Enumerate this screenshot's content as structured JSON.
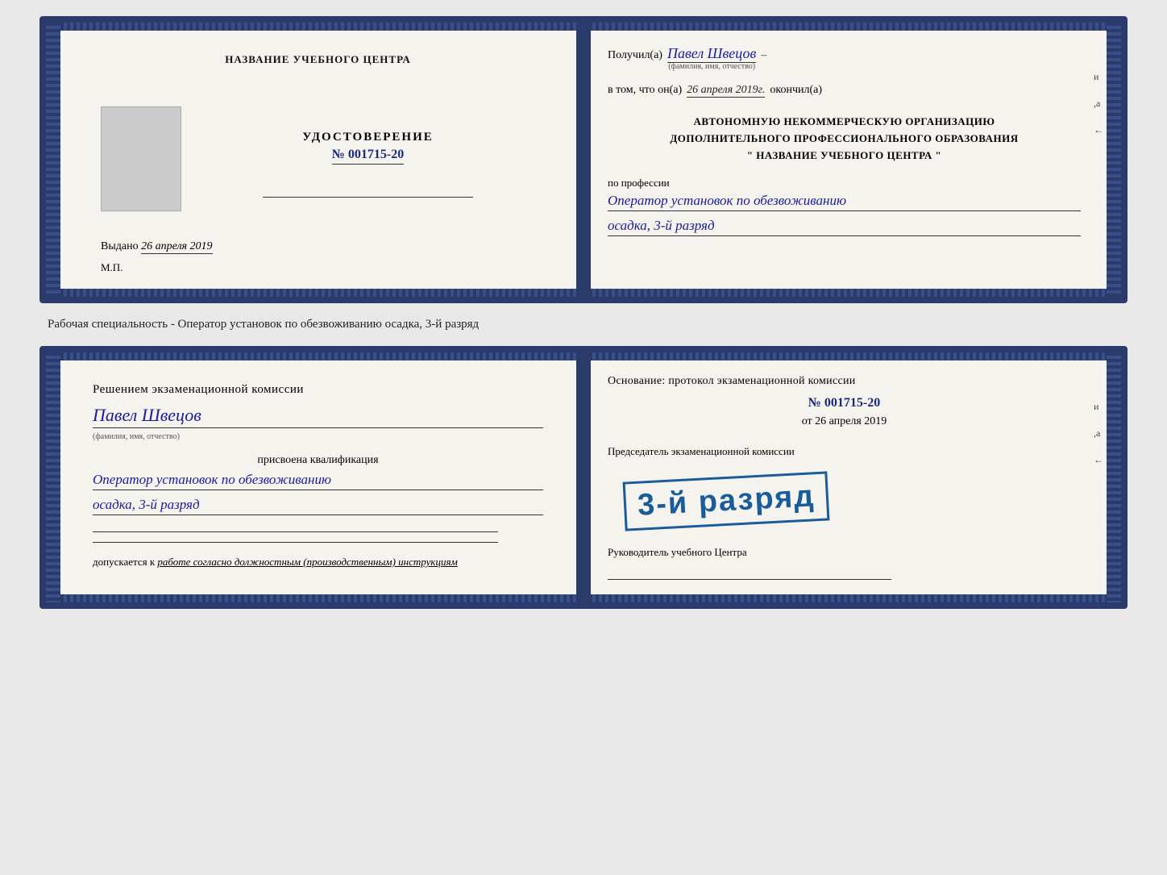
{
  "topDoc": {
    "leftSide": {
      "centerTitle": "НАЗВАНИЕ УЧЕБНОГО ЦЕНТРА",
      "udostLabel": "УДОСТОВЕРЕНИЕ",
      "udostNumber": "№ 001715-20",
      "vydanoLabel": "Выдано",
      "vydanoDate": "26 апреля 2019",
      "mpLabel": "М.П."
    },
    "rightSide": {
      "poluchilLabel": "Получил(а)",
      "receivedName": "Павел Швецов",
      "nameHint": "(фамилия, имя, отчество)",
      "vtomLabel": "в том, что он(а)",
      "vtomDate": "26 апреля 2019г.",
      "okonchilLabel": "окончил(а)",
      "orgLine1": "АВТОНОМНУЮ НЕКОММЕРЧЕСКУЮ ОРГАНИЗАЦИЮ",
      "orgLine2": "ДОПОЛНИТЕЛЬНОГО ПРОФЕССИОНАЛЬНОГО ОБРАЗОВАНИЯ",
      "orgLine3": "\"   НАЗВАНИЕ УЧЕБНОГО ЦЕНТРА   \"",
      "professiiLabel": "по профессии",
      "professionValue": "Оператор установок по обезвоживанию",
      "rankValue": "осадка, 3-й разряд"
    }
  },
  "separatorText": "Рабочая специальность - Оператор установок по обезвоживанию осадка, 3-й разряд",
  "bottomDoc": {
    "leftSide": {
      "reshenieLabel": "Решением экзаменационной комиссии",
      "personName": "Павел Швецов",
      "nameHint": "(фамилия, имя, отчество)",
      "prisvoenaLabel": "присвоена квалификация",
      "professionValue": "Оператор установок по обезвоживанию",
      "rankValue": "осадка, 3-й разряд",
      "dopuskaetsyaLabel": "допускается к",
      "dopuskaetsyaValue": "работе согласно должностным (производственным) инструкциям"
    },
    "rightSide": {
      "osnovLabel": "Основание: протокол экзаменационной комиссии",
      "protocolNumber": "№  001715-20",
      "otLabel": "от",
      "protocolDate": "26 апреля 2019",
      "predsedatelLabel": "Председатель экзаменационной комиссии",
      "stampText": "3-й разряд",
      "rukovoditelLabel": "Руководитель учебного Центра"
    }
  },
  "rightLabels": {
    "label1": "и",
    "label2": ",а",
    "label3": "←"
  }
}
